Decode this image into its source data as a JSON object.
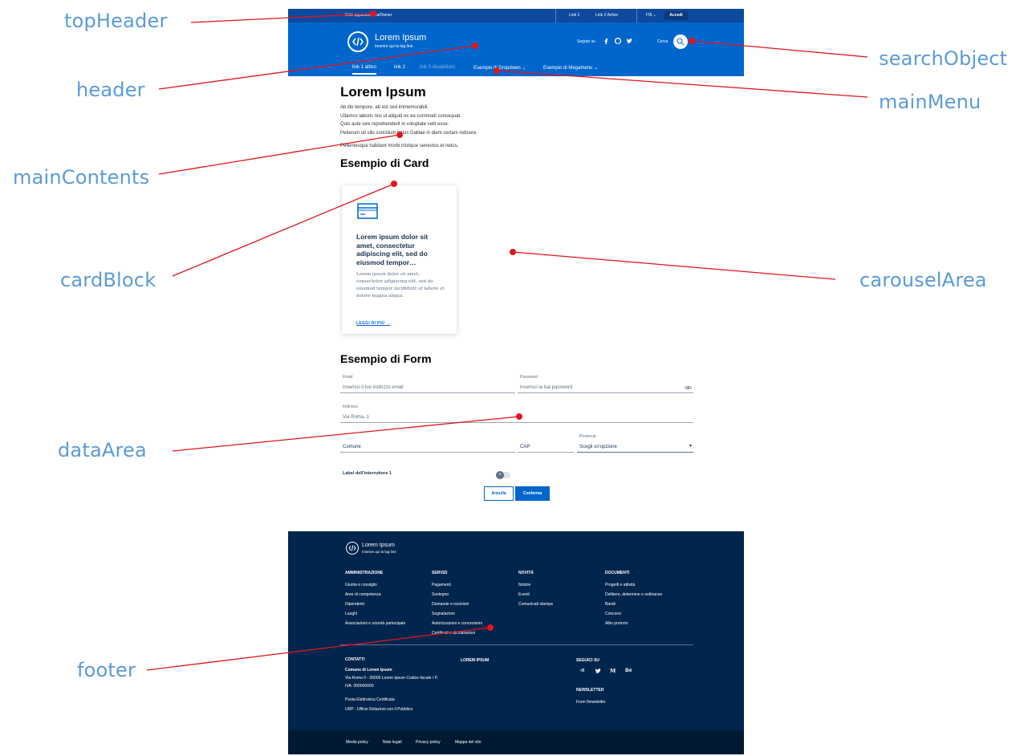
{
  "annotations": {
    "topHeader": "topHeader",
    "header": "header",
    "mainContents": "mainContents",
    "cardBlock": "cardBlock",
    "dataArea": "dataArea",
    "footer": "footer",
    "searchObject": "searchObject",
    "mainMenu": "mainMenu",
    "carouselArea": "carouselArea"
  },
  "colors": {
    "annotation_text": "#5b9bd5",
    "annotation_line": "#e0161e",
    "primary": "#0066cc",
    "footer_bg": "#01254c"
  },
  "top_header": {
    "owner": "Ente appartenenza/Owner",
    "links": [
      "Link 1",
      "Link 2 Active"
    ],
    "language": "ITA",
    "login": "Accedi"
  },
  "header": {
    "title": "Lorem Ipsum",
    "tagline": "Inserire qui la tag line",
    "social_label": "Seguici su",
    "social_icons": [
      "facebook-icon",
      "github-icon",
      "twitter-icon"
    ],
    "search_label": "Cerca"
  },
  "main_menu": {
    "items": [
      "link 1 attivo",
      "link 2",
      "link 3 disabilitato",
      "Esempio di Dropdown",
      "Esempio di Megamenu"
    ]
  },
  "main": {
    "title": "Lorem Ipsum",
    "paragraph_lines": [
      "Ab illo tempore, ab est sed immemorabili.",
      "Ullamco laboris nisi ut aliquid ex ea commodi consequat.",
      "Quis aute iure reprehenderit in voluptate velit esse.",
      "Petierunt uti sibi concilium totius Galliae in diem certam indicere."
    ],
    "paragraph2": "Pellentesque habitant morbi tristique senectus et netus.",
    "card_section_title": "Esempio di Card"
  },
  "card": {
    "title": "Lorem ipsum dolor sit amet, consectetur adipiscing elit, sed do eiusmod tempor…",
    "text": "Lorem ipsum dolor sit amet, consectetur adipiscing elit, sed do eiusmod tempor incididunt ut labore et dolore magna aliqua.",
    "link": "LEGGI DI PIÙ"
  },
  "form": {
    "title": "Esempio di Form",
    "email_label": "Email",
    "email_placeholder": "inserisci il tuo indirizzo email",
    "password_label": "Password",
    "password_placeholder": "inserisci la tua password",
    "address_label": "Indirizzo",
    "address_value": "Via Roma, 1",
    "city_placeholder": "Comune",
    "zip_placeholder": "CAP",
    "province_label": "Provincia",
    "province_value": "Scegli un'opzione",
    "toggle_label": "Label dell'interruttore 1",
    "cancel": "Annulla",
    "confirm": "Conferma"
  },
  "footer": {
    "brand": "Lorem Ipsum",
    "tagline": "Inserire qui la tag line",
    "columns": [
      {
        "title": "AMMINISTRAZIONE",
        "items": [
          "Giunta e consiglio",
          "Aree di competenza",
          "Dipendenti",
          "Luoghi",
          "Associazioni e società partecipate"
        ]
      },
      {
        "title": "SERVIZI",
        "items": [
          "Pagamenti",
          "Sostegno",
          "Domande e iscrizioni",
          "Segnalazioni",
          "Autorizzazioni e concessioni",
          "Certificati e dichiarazioni"
        ]
      },
      {
        "title": "NOVITÀ",
        "items": [
          "Notizie",
          "Eventi",
          "Comunicati stampa"
        ]
      },
      {
        "title": "DOCUMENTI",
        "items": [
          "Progetti e attività",
          "Delibere, determine e ordinanze",
          "Bandi",
          "Concorsi",
          "Albo pretorio"
        ]
      }
    ],
    "contacts_title": "CONTATTI",
    "contacts_name": "Comune di Lorem Ipsum",
    "contacts_address": "Via Roma 0 - 00000 Lorem Ipsum Codice fiscale / P.",
    "contacts_vat": "IVA: 000000000",
    "contacts_pec": "Posta Elettronica Certificata",
    "contacts_urp": "URP - Ufficio Relazioni con il Pubblico",
    "lorem_title": "LOREM IPSUM",
    "follow_title": "SEGUICI SU",
    "follow_icons": [
      "designers-italia-icon",
      "twitter-icon",
      "medium-icon",
      "behance-icon"
    ],
    "follow_glyphs": [
      "·ıt",
      "",
      "M",
      "Bé"
    ],
    "newsletter_title": "NEWSLETTER",
    "newsletter_link": "Form Newsletter"
  },
  "bottom_links": [
    "Media policy",
    "Note legali",
    "Privacy policy",
    "Mappa del sito"
  ]
}
